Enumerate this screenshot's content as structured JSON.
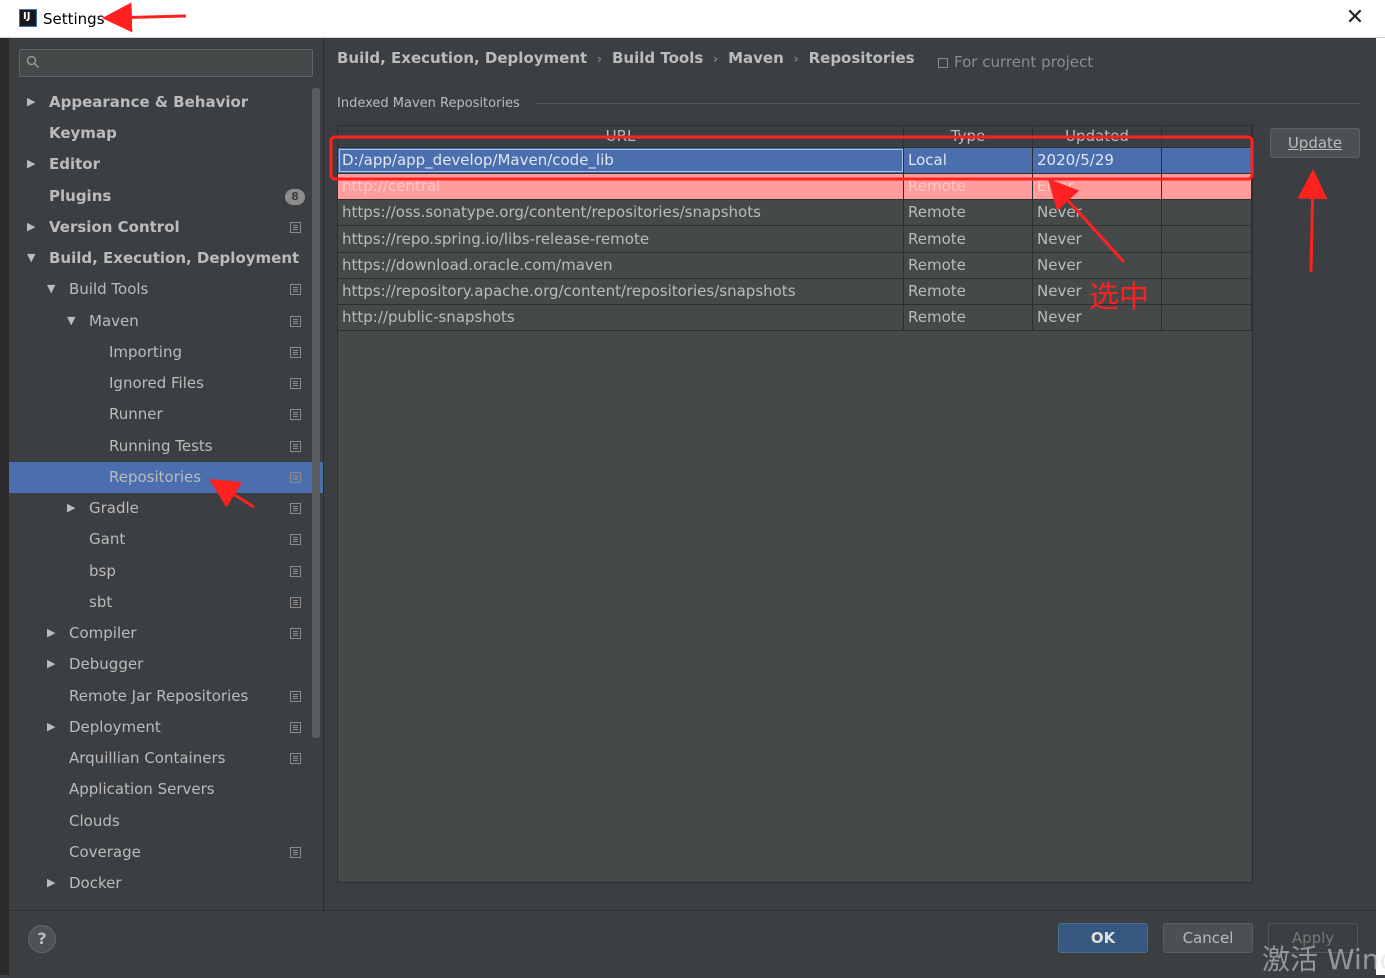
{
  "window": {
    "title": "Settings",
    "close": "✕"
  },
  "search": {
    "placeholder": ""
  },
  "tree": [
    {
      "label": "Appearance & Behavior",
      "bold": true
    },
    {
      "label": "Keymap",
      "bold": true
    },
    {
      "label": "Editor",
      "bold": true
    },
    {
      "label": "Plugins",
      "bold": true,
      "badge": "8"
    },
    {
      "label": "Version Control",
      "bold": true
    },
    {
      "label": "Build, Execution, Deployment",
      "bold": true
    },
    {
      "label": "Build Tools"
    },
    {
      "label": "Maven"
    },
    {
      "label": "Importing"
    },
    {
      "label": "Ignored Files"
    },
    {
      "label": "Runner"
    },
    {
      "label": "Running Tests"
    },
    {
      "label": "Repositories",
      "selected": true
    },
    {
      "label": "Gradle"
    },
    {
      "label": "Gant"
    },
    {
      "label": "bsp"
    },
    {
      "label": "sbt"
    },
    {
      "label": "Compiler"
    },
    {
      "label": "Debugger"
    },
    {
      "label": "Remote Jar Repositories"
    },
    {
      "label": "Deployment"
    },
    {
      "label": "Arquillian Containers"
    },
    {
      "label": "Application Servers"
    },
    {
      "label": "Clouds"
    },
    {
      "label": "Coverage"
    },
    {
      "label": "Docker"
    }
  ],
  "breadcrumb": [
    "Build, Execution, Deployment",
    "Build Tools",
    "Maven",
    "Repositories"
  ],
  "scope_label": "For current project",
  "section_title": "Indexed Maven Repositories",
  "table": {
    "columns": [
      "URL",
      "Type",
      "Updated"
    ],
    "rows": [
      {
        "url": "D:/app/app_develop/Maven/code_lib",
        "type": "Local",
        "updated": "2020/5/29"
      },
      {
        "url": "http://central",
        "type": "Remote",
        "updated": "Error"
      },
      {
        "url": "https://oss.sonatype.org/content/repositories/snapshots",
        "type": "Remote",
        "updated": "Never"
      },
      {
        "url": "https://repo.spring.io/libs-release-remote",
        "type": "Remote",
        "updated": "Never"
      },
      {
        "url": "https://download.oracle.com/maven",
        "type": "Remote",
        "updated": "Never"
      },
      {
        "url": "https://repository.apache.org/content/repositories/snapshots",
        "type": "Remote",
        "updated": "Never"
      },
      {
        "url": "http://public-snapshots",
        "type": "Remote",
        "updated": "Never"
      }
    ]
  },
  "buttons": {
    "update": "Update",
    "ok": "OK",
    "cancel": "Cancel",
    "apply": "Apply",
    "help": "?"
  },
  "annotation": {
    "text": "选中",
    "color": "#ff2020"
  },
  "watermark": "激活 Windo",
  "colors": {
    "selection": "#4b6eaf",
    "background": "#3c3f41",
    "error_row": "#ff9c9c",
    "ok_button": "#365880"
  }
}
